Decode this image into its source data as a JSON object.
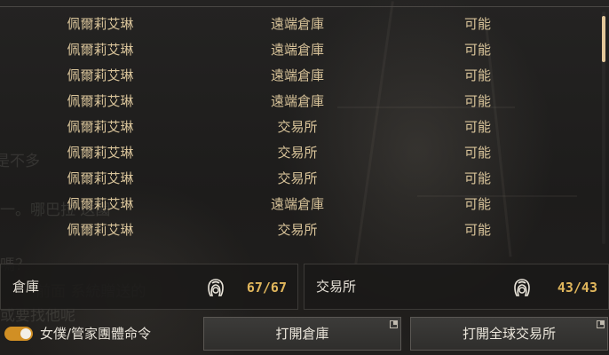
{
  "list": {
    "rows": [
      {
        "name": "佩爾莉艾琳",
        "location": "遠端倉庫",
        "status": "可能"
      },
      {
        "name": "佩爾莉艾琳",
        "location": "遠端倉庫",
        "status": "可能"
      },
      {
        "name": "佩爾莉艾琳",
        "location": "遠端倉庫",
        "status": "可能"
      },
      {
        "name": "佩爾莉艾琳",
        "location": "遠端倉庫",
        "status": "可能"
      },
      {
        "name": "佩爾莉艾琳",
        "location": "交易所",
        "status": "可能"
      },
      {
        "name": "佩爾莉艾琳",
        "location": "交易所",
        "status": "可能"
      },
      {
        "name": "佩爾莉艾琳",
        "location": "交易所",
        "status": "可能"
      },
      {
        "name": "佩爾莉艾琳",
        "location": "遠端倉庫",
        "status": "可能"
      },
      {
        "name": "佩爾莉艾琳",
        "location": "交易所",
        "status": "可能"
      }
    ]
  },
  "storage": {
    "label": "倉庫",
    "count": "67/67",
    "icon": "maid-icon"
  },
  "market": {
    "label": "交易所",
    "count": "43/43",
    "icon": "maid-icon"
  },
  "toggle": {
    "label": "女僕/管家團體命令",
    "on": true,
    "color": "#d18f24"
  },
  "buttons": {
    "open_storage": "打開倉庫",
    "open_market": "打開全球交易所"
  },
  "colors": {
    "accent": "#e0b65c",
    "row_text": "#d9c49a"
  }
}
